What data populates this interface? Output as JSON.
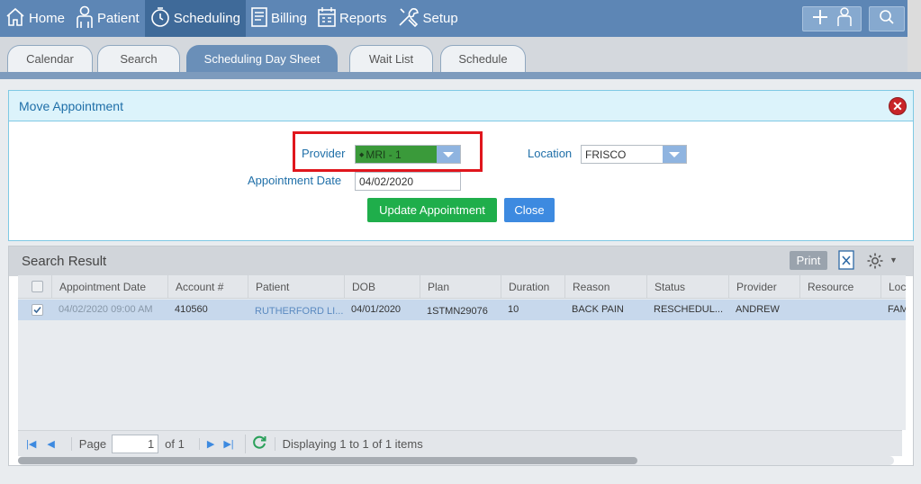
{
  "nav": {
    "items": [
      {
        "label": "Home",
        "icon": "home-icon"
      },
      {
        "label": "Patient",
        "icon": "patient-icon"
      },
      {
        "label": "Scheduling",
        "icon": "clock-icon"
      },
      {
        "label": "Billing",
        "icon": "billing-icon"
      },
      {
        "label": "Reports",
        "icon": "calendar-icon"
      },
      {
        "label": "Setup",
        "icon": "tools-icon"
      }
    ],
    "active": "Scheduling"
  },
  "tabs": [
    {
      "label": "Calendar"
    },
    {
      "label": "Search"
    },
    {
      "label": "Scheduling Day Sheet"
    },
    {
      "label": "Wait List"
    },
    {
      "label": "Schedule"
    }
  ],
  "dialog": {
    "title": "Move Appointment",
    "provider_label": "Provider",
    "provider_value": "MRI - 1",
    "location_label": "Location",
    "location_value": "FRISCO",
    "date_label": "Appointment Date",
    "date_value": "04/02/2020",
    "update_button": "Update Appointment",
    "close_button": "Close"
  },
  "results": {
    "title": "Search Result",
    "print_label": "Print",
    "columns": [
      "Appointment Date",
      "Account #",
      "Patient",
      "DOB",
      "Plan",
      "Duration",
      "Reason",
      "Status",
      "Provider",
      "Resource",
      "Loc"
    ],
    "rows": [
      {
        "appointment_date": "04/02/2020 09:00 AM",
        "account": "410560",
        "patient": "RUTHERFORD LI...",
        "dob": "04/01/2020",
        "plan": "1STMN29076",
        "duration": "10",
        "reason": "BACK PAIN",
        "status": "RESCHEDUL...",
        "provider": "ANDREW",
        "resource": "",
        "loc": "FAM"
      }
    ],
    "pager": {
      "page_label": "Page",
      "page_value": "1",
      "of_label": "of 1",
      "summary": "Displaying 1 to 1 of 1 items"
    }
  },
  "colors": {
    "nav_bg": "#5d86b5",
    "nav_active": "#3f6a99",
    "accent_blue": "#3d8ae0",
    "green_button": "#1fae4b",
    "provider_green": "#3a9a3a",
    "highlight_red": "#e0161d"
  }
}
